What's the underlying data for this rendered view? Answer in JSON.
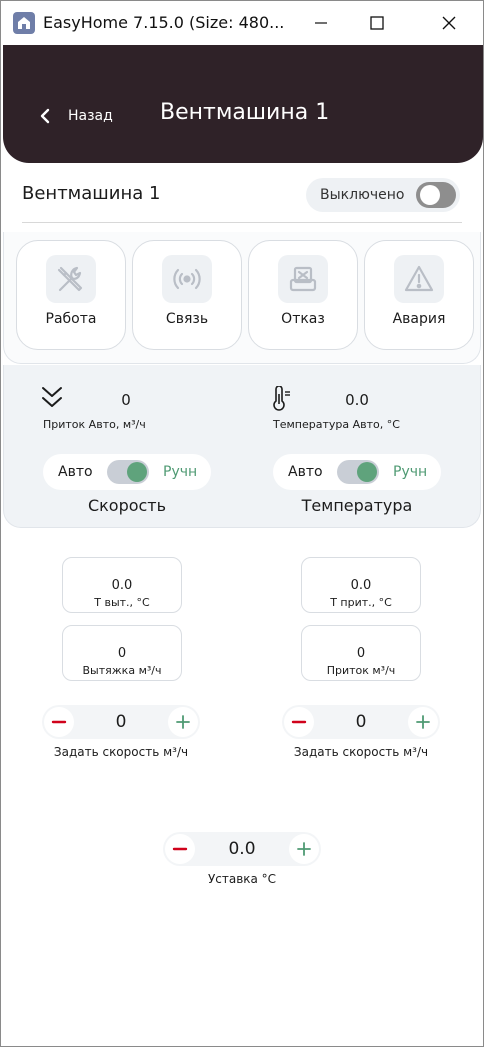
{
  "window": {
    "title": "EasyHome 7.15.0 (Size: 480...",
    "app_icon": "easyhome-house-icon",
    "controls": [
      "minimize-icon",
      "maximize-icon",
      "close-icon"
    ]
  },
  "header": {
    "back_label": "Назад",
    "title": "Вентмашина 1",
    "background": "#2f2228"
  },
  "device": {
    "name": "Вентмашина 1",
    "power_label": "Выключено",
    "power_on": false
  },
  "status_cards": [
    {
      "label": "Работа",
      "icon": "tools-icon"
    },
    {
      "label": "Связь",
      "icon": "signal-broadcast-icon"
    },
    {
      "label": "Отказ",
      "icon": "printer-error-icon"
    },
    {
      "label": "Авария",
      "icon": "warning-triangle-icon"
    }
  ],
  "metrics": {
    "supply": {
      "value": "0",
      "label": "Приток Авто, м³/ч",
      "icon": "double-chevron-down-icon"
    },
    "temperature": {
      "value": "0.0",
      "label": "Температура Авто, °С",
      "icon": "thermometer-icon"
    }
  },
  "modes": {
    "speed": {
      "auto_label": "Авто",
      "manual_label": "Ручн",
      "title": "Скорость",
      "manual_selected": true
    },
    "temperature": {
      "auto_label": "Авто",
      "manual_label": "Ручн",
      "title": "Температура",
      "manual_selected": true
    }
  },
  "readouts": {
    "t_exhaust": {
      "value": "0.0",
      "label": "Т выт., °С"
    },
    "t_supply": {
      "value": "0.0",
      "label": "Т прит., °С"
    },
    "exhaust_flow": {
      "value": "0",
      "label": "Вытяжка м³/ч"
    },
    "supply_flow": {
      "value": "0",
      "label": "Приток м³/ч"
    }
  },
  "steppers": {
    "exhaust_speed": {
      "value": "0",
      "caption": "Задать скорость м³/ч"
    },
    "supply_speed": {
      "value": "0",
      "caption": "Задать скорость м³/ч"
    },
    "setpoint": {
      "value": "0.0",
      "caption": "Уставка °С"
    }
  },
  "colors": {
    "accent_green": "#4f9a73",
    "minus_red": "#d0021b",
    "status_icon_gray": "#b9bec6"
  }
}
